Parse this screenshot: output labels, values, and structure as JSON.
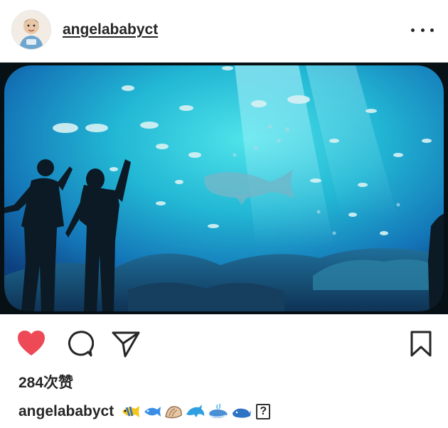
{
  "post": {
    "username": "angelababyct",
    "likes_label": "284次赞",
    "caption_username": "angelababyct"
  },
  "icons": {
    "like": "heart-icon",
    "comment": "comment-icon",
    "share": "send-icon",
    "save": "bookmark-icon",
    "more": "more-options-icon"
  },
  "colors": {
    "like_active": "#ed4956",
    "text": "#262626"
  },
  "caption_emojis": [
    "tropical-fish",
    "fish",
    "shell",
    "dolphin",
    "spouting-whale",
    "whale",
    "unsupported-glyph"
  ],
  "missing_glyph_text": "?"
}
